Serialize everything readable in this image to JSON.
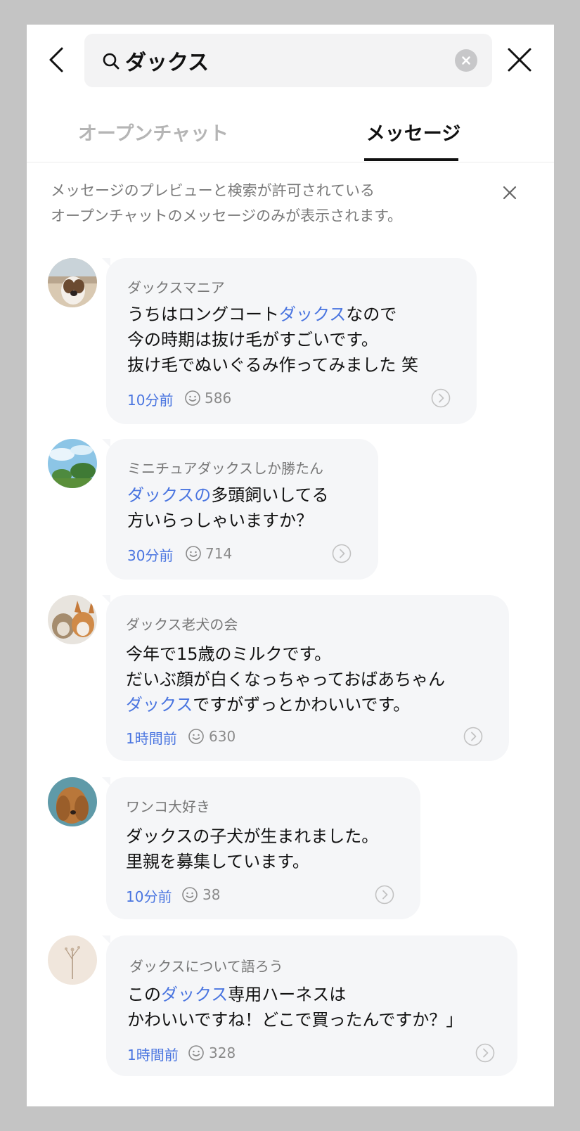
{
  "search": {
    "query": "ダックス"
  },
  "tabs": [
    {
      "label": "オープンチャット",
      "active": false
    },
    {
      "label": "メッセージ",
      "active": true
    }
  ],
  "notice": {
    "lines": [
      "メッセージのプレビューと検索が許可されている",
      "オープンチャットのメッセージのみが表示されます。"
    ]
  },
  "highlight_color": "#4a75e0",
  "results": [
    {
      "room": "ダックスマニア",
      "lines": [
        [
          "うちはロングコート",
          "ダックス",
          "なので"
        ],
        [
          "今の時期は抜け毛がすごいです。"
        ],
        [
          "抜け毛でぬいぐるみ作ってみました 笑"
        ]
      ],
      "time": "10分前",
      "members": "586",
      "avatar": "dog-on-beach"
    },
    {
      "room": "ミニチュアダックスしか勝たん",
      "lines": [
        [
          "",
          "ダックスの",
          "多頭飼いしてる"
        ],
        [
          "方いらっしゃいますか？"
        ]
      ],
      "time": "30分前",
      "members": "714",
      "avatar": "sky-and-trees"
    },
    {
      "room": "ダックス老犬の会",
      "lines": [
        [
          "今年で15歳のミルクです。"
        ],
        [
          "だいぶ顔が白くなっちゃっておばあちゃん"
        ],
        [
          "",
          "ダックス",
          "ですがずっとかわいいです。"
        ]
      ],
      "time": "1時間前",
      "members": "630",
      "avatar": "two-dogs"
    },
    {
      "room": "ワンコ大好き",
      "lines": [
        [
          "ダックスの子犬が生まれました。"
        ],
        [
          "里親を募集しています。"
        ]
      ],
      "time": "10分前",
      "members": "38",
      "avatar": "long-haired-dog"
    },
    {
      "room": "ダックスについて語ろう",
      "lines": [
        [
          "この",
          "ダックス",
          "専用ハーネスは"
        ],
        [
          "かわいいですね！どこで買ったんですか？」"
        ]
      ],
      "time": "1時間前",
      "members": "328",
      "avatar": "dried-flower"
    }
  ]
}
